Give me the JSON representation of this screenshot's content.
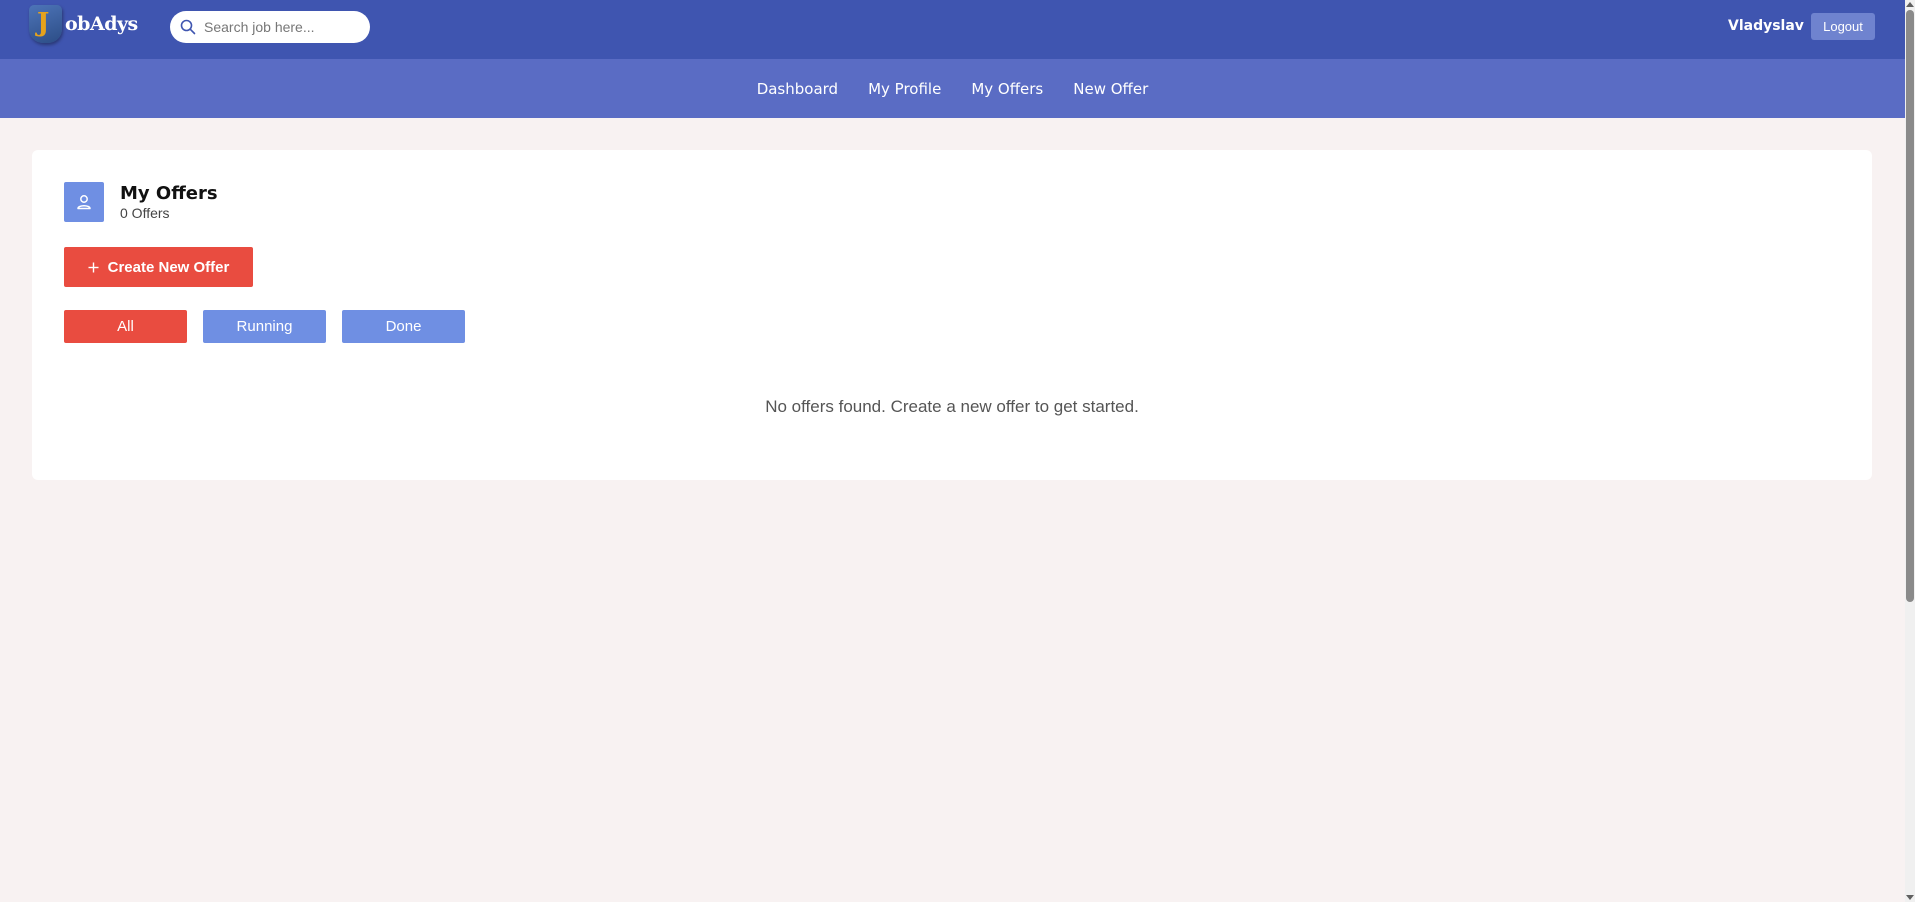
{
  "header": {
    "logo_letter": "J",
    "logo_text": "obAdys",
    "search_placeholder": "Search job here...",
    "username": "Vladyslav",
    "logout_label": "Logout"
  },
  "nav": {
    "items": [
      {
        "label": "Dashboard"
      },
      {
        "label": "My Profile"
      },
      {
        "label": "My Offers"
      },
      {
        "label": "New Offer"
      }
    ]
  },
  "offers": {
    "title": "My Offers",
    "count_text": "0 Offers",
    "create_label": "Create New Offer",
    "create_icon": "plus-icon",
    "header_icon": "user-icon",
    "filters": [
      {
        "label": "All",
        "active": true
      },
      {
        "label": "Running",
        "active": false
      },
      {
        "label": "Done",
        "active": false
      }
    ],
    "empty_message": "No offers found. Create a new offer to get started."
  },
  "colors": {
    "topbar": "#3f55b0",
    "navbar": "#5a6cc4",
    "accent_red": "#e94c40",
    "accent_blue": "#6f8fe3",
    "page_bg": "#f8f2f2"
  }
}
